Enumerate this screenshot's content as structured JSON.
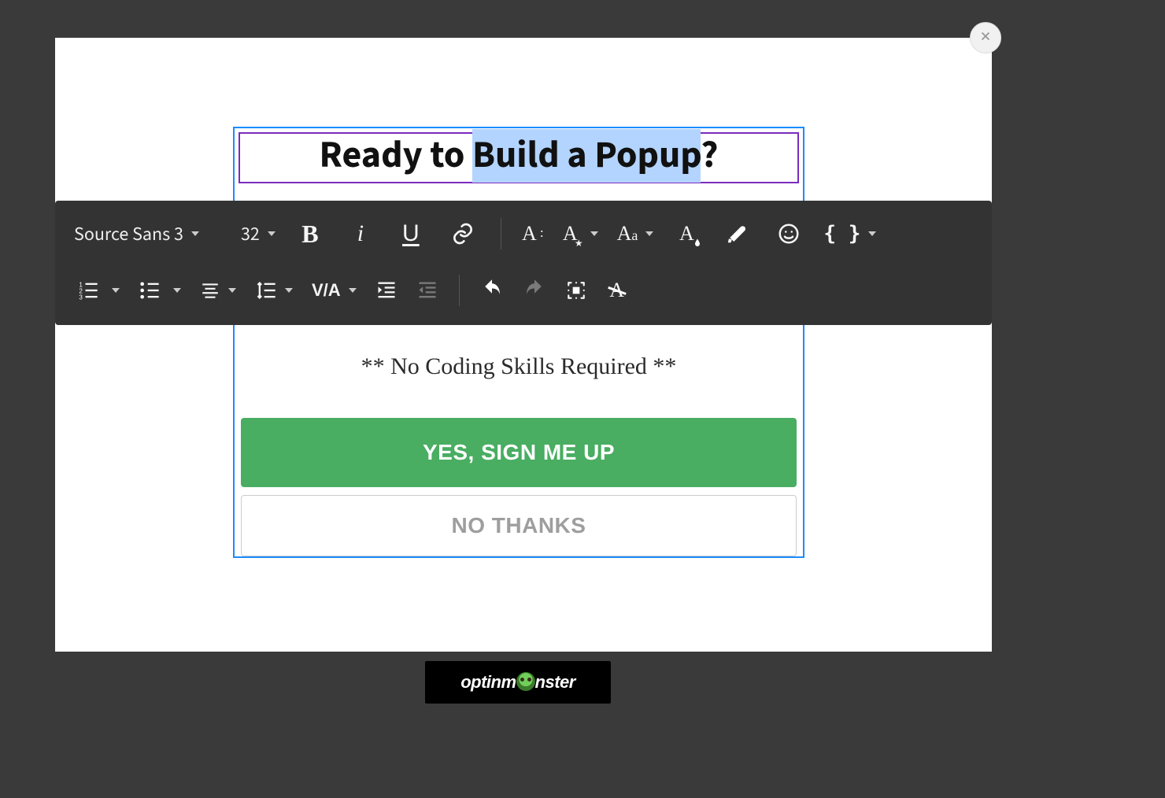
{
  "close_label": "Close",
  "toolbar": {
    "font_family": "Source Sans 3",
    "font_size": "32",
    "icons": {
      "bold": "bold-icon",
      "italic": "italic-icon",
      "underline": "underline-icon",
      "link": "link-icon",
      "typography": "typography-icon",
      "text_style": "text-style-icon",
      "text_case": "text-case-icon",
      "text_color": "text-color-icon",
      "highlight": "highlight-icon",
      "emoji": "emoji-icon",
      "merge_tags": "merge-tags-icon",
      "ordered_list": "ordered-list-icon",
      "unordered_list": "unordered-list-icon",
      "align": "align-icon",
      "line_height": "line-height-icon",
      "kerning_label": "V/A",
      "indent": "indent-increase-icon",
      "outdent": "indent-decrease-icon",
      "undo": "undo-icon",
      "redo": "redo-icon",
      "select_all": "select-all-icon",
      "clear_format": "clear-format-icon"
    }
  },
  "popup": {
    "headline_pre": "Ready to ",
    "headline_selected": "Build a Popup",
    "headline_post": "?",
    "subhead": "** No Coding Skills Required **",
    "yes_label": "YES, SIGN ME UP",
    "no_label": "NO THANKS"
  },
  "brand": {
    "pre": "optinm",
    "post": "nster"
  }
}
